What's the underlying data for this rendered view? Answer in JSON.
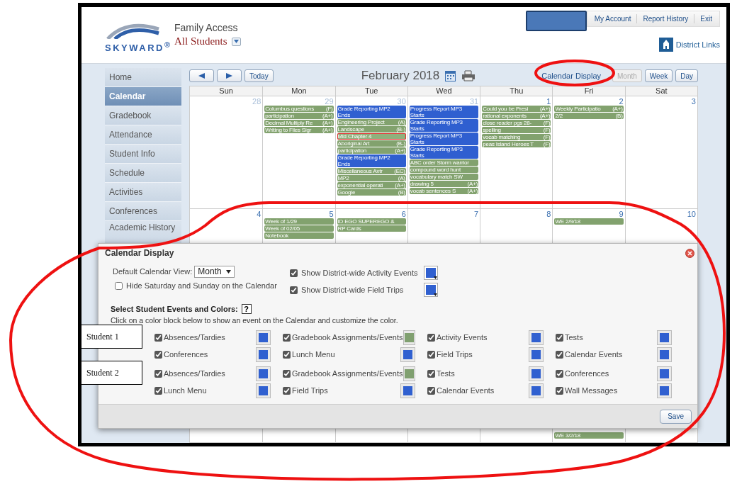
{
  "header": {
    "logo_text": "SKYWARD$^{®}$",
    "app_title": "Family Access",
    "student_select": "All Students",
    "top_links": [
      "My Account",
      "Report History",
      "Exit"
    ],
    "district_links": "District Links"
  },
  "sidebar": {
    "items": [
      {
        "label": "Home",
        "selected": false
      },
      {
        "label": "Calendar",
        "selected": true
      },
      {
        "label": "Gradebook",
        "selected": false
      },
      {
        "label": "Attendance",
        "selected": false
      },
      {
        "label": "Student Info",
        "selected": false
      },
      {
        "label": "Schedule",
        "selected": false
      },
      {
        "label": "Activities",
        "selected": false
      },
      {
        "label": "Conferences",
        "selected": false
      },
      {
        "label": "Academic History",
        "selected": false
      }
    ]
  },
  "calendar": {
    "today_button": "Today",
    "title": "February 2018",
    "display_link": "Calendar Display",
    "views": [
      {
        "label": "Month",
        "disabled": true
      },
      {
        "label": "Week",
        "disabled": false
      },
      {
        "label": "Day",
        "disabled": false
      }
    ],
    "weekdays": [
      "Sun",
      "Mon",
      "Tue",
      "Wed",
      "Thu",
      "Fri",
      "Sat"
    ],
    "weeks": [
      {
        "days": [
          {
            "num": "28",
            "other_month": true
          },
          {
            "num": "29",
            "other_month": true,
            "events": [
              {
                "title": "Columbus questions",
                "grade": "(F)",
                "kind": "grade"
              },
              {
                "title": "participation",
                "grade": "(A+)",
                "kind": "grade"
              },
              {
                "title": "Decimal Multiply Re",
                "grade": "(A+)",
                "kind": "grade"
              },
              {
                "title": "Writing to Files Sigr",
                "grade": "(A+)",
                "kind": "grade"
              }
            ]
          },
          {
            "num": "30",
            "other_month": true,
            "events": [
              {
                "title": "Grade Reporting MP2 Ends",
                "kind": "report"
              },
              {
                "title": "Engineering Project",
                "grade": "(A)",
                "kind": "grade"
              },
              {
                "title": "Landscape",
                "grade": "(B-)",
                "kind": "grade"
              },
              {
                "title": "Mid Chapter 4",
                "kind": "flagged"
              },
              {
                "title": "Aboriginal Art",
                "grade": "(B-)",
                "kind": "grade"
              },
              {
                "title": "participation",
                "grade": "(A+)",
                "kind": "grade"
              },
              {
                "title": "Grade Reporting MP2 Ends",
                "kind": "report"
              },
              {
                "title": "Miscellaneous Axtr",
                "grade": "(EC)",
                "kind": "grade"
              },
              {
                "title": "MP2",
                "grade": "(A)",
                "kind": "grade"
              },
              {
                "title": "exponential operati",
                "grade": "(A+)",
                "kind": "grade"
              },
              {
                "title": "Google",
                "grade": "(B)",
                "kind": "grade"
              }
            ]
          },
          {
            "num": "31",
            "other_month": true,
            "events": [
              {
                "title": "Progress Report MP3 Starts",
                "kind": "report"
              },
              {
                "title": "Grade Reporting MP3 Starts",
                "kind": "report"
              },
              {
                "title": "Progress Report MP3 Starts",
                "kind": "report"
              },
              {
                "title": "Grade Reporting MP3 Starts",
                "kind": "report"
              },
              {
                "title": "ABC order Storm warrior",
                "kind": "grade"
              },
              {
                "title": "compound word hunt",
                "kind": "grade"
              },
              {
                "title": "vocabulary match SW",
                "kind": "grade"
              },
              {
                "title": "drawing 5",
                "grade": "(A+)",
                "kind": "grade"
              },
              {
                "title": "vocab sentences S",
                "grade": "(A+)",
                "kind": "grade"
              }
            ]
          },
          {
            "num": "1",
            "other_month": false,
            "events": [
              {
                "title": "Could you be Presi",
                "grade": "(A+)",
                "kind": "grade"
              },
              {
                "title": "rational exponents",
                "grade": "(A+)",
                "kind": "grade"
              },
              {
                "title": "close reader pgs 28-",
                "grade": "(F)",
                "kind": "grade"
              },
              {
                "title": "spelling",
                "grade": "(F)",
                "kind": "grade"
              },
              {
                "title": "vocab matching",
                "grade": "(F)",
                "kind": "grade"
              },
              {
                "title": "peas Island Heroes T",
                "grade": "(F)",
                "kind": "grade"
              }
            ]
          },
          {
            "num": "2",
            "other_month": false,
            "events": [
              {
                "title": "Weekly Participatio",
                "grade": "(A+)",
                "kind": "grade"
              },
              {
                "title": "2/2",
                "grade": "(B)",
                "kind": "grade"
              }
            ]
          },
          {
            "num": "3",
            "other_month": false
          }
        ]
      },
      {
        "days": [
          {
            "num": "4",
            "other_month": false
          },
          {
            "num": "5",
            "other_month": false,
            "events": [
              {
                "title": "Week of 1/29",
                "kind": "grade"
              },
              {
                "title": "Week of 02/05",
                "kind": "grade"
              },
              {
                "title": "Notebook",
                "kind": "grade"
              }
            ]
          },
          {
            "num": "6",
            "other_month": false,
            "events": [
              {
                "title": "ID EGO SUPEREGO &",
                "kind": "grade"
              },
              {
                "title": "RP Cards",
                "kind": "grade"
              }
            ]
          },
          {
            "num": "7",
            "other_month": false
          },
          {
            "num": "8",
            "other_month": false
          },
          {
            "num": "9",
            "other_month": false,
            "events": [
              {
                "title": "WE 2/9/18",
                "kind": "grade"
              }
            ]
          },
          {
            "num": "10",
            "other_month": false
          }
        ]
      }
    ],
    "last_row_friday_events": [
      {
        "title": "WE 3/2/18",
        "kind": "grade"
      }
    ]
  },
  "dialog": {
    "title": "Calendar Display",
    "default_view_label": "Default Calendar View:",
    "default_view": "Month",
    "hide_weekend": {
      "label": "Hide Saturday and Sunday on the Calendar",
      "checked": false
    },
    "district_options": [
      {
        "label": "Show District-wide Activity Events",
        "checked": true,
        "color": "#3060d0"
      },
      {
        "label": "Show District-wide Field Trips",
        "checked": true,
        "color": "#3060d0"
      }
    ],
    "section_title": "Select Student Events and Colors:",
    "help_button": "?",
    "instruction": "Click on a color block below to show an event on the Calendar and customize the color.",
    "students": [
      {
        "callout": "Student 1",
        "items": [
          {
            "label": "Absences/Tardies",
            "checked": true,
            "color": "#3060d0"
          },
          {
            "label": "Gradebook Assignments/Events",
            "checked": true,
            "color": "#80a070"
          },
          {
            "label": "Activity Events",
            "checked": true,
            "color": "#3060d0"
          },
          {
            "label": "Tests",
            "checked": true,
            "color": "#3060d0"
          },
          {
            "label": "Conferences",
            "checked": true,
            "color": "#3060d0"
          },
          {
            "label": "Lunch Menu",
            "checked": true,
            "color": "#3060d0"
          },
          {
            "label": "Field Trips",
            "checked": true,
            "color": "#3060d0"
          },
          {
            "label": "Calendar Events",
            "checked": true,
            "color": "#3060d0"
          }
        ]
      },
      {
        "callout": "Student 2",
        "items": [
          {
            "label": "Absences/Tardies",
            "checked": true,
            "color": "#3060d0"
          },
          {
            "label": "Gradebook Assignments/Events",
            "checked": true,
            "color": "#80a070"
          },
          {
            "label": "Tests",
            "checked": true,
            "color": "#3060d0"
          },
          {
            "label": "Conferences",
            "checked": true,
            "color": "#3060d0"
          },
          {
            "label": "Lunch Menu",
            "checked": true,
            "color": "#3060d0"
          },
          {
            "label": "Field Trips",
            "checked": true,
            "color": "#3060d0"
          },
          {
            "label": "Calendar Events",
            "checked": true,
            "color": "#3060d0"
          },
          {
            "label": "Wall Messages",
            "checked": true,
            "color": "#3060d0"
          }
        ]
      }
    ],
    "save_button": "Save"
  }
}
